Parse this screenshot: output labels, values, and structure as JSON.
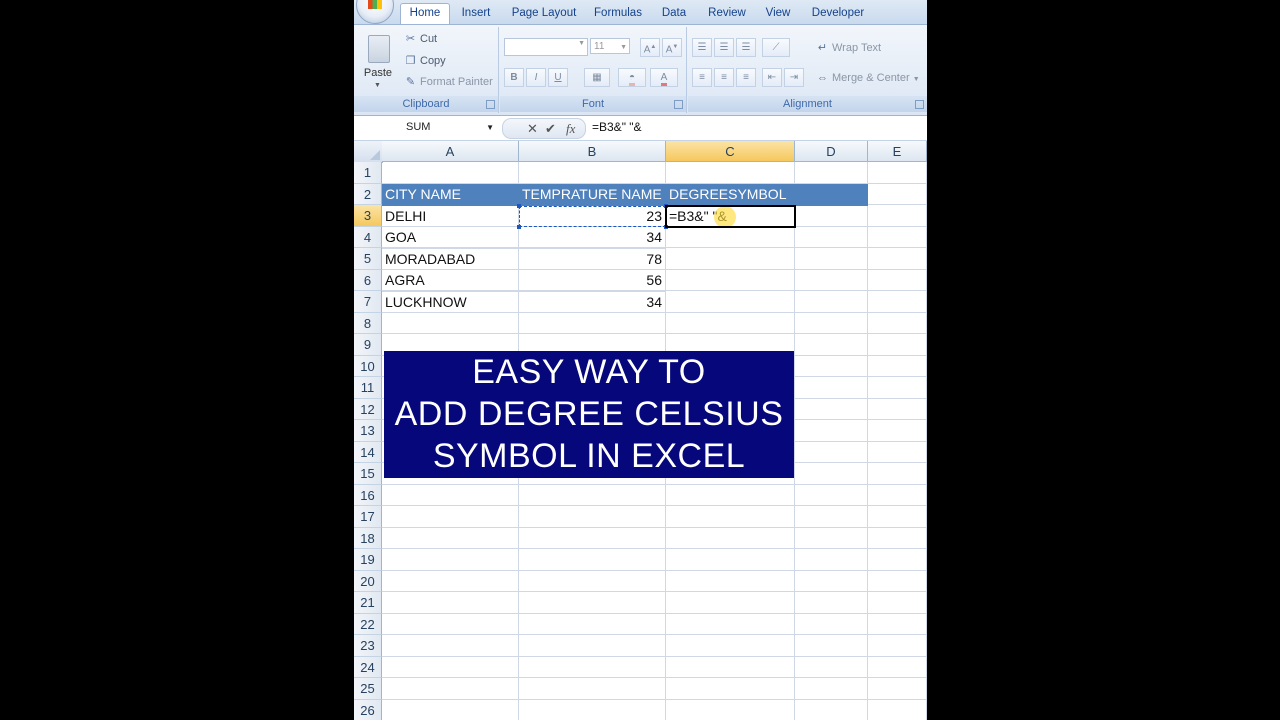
{
  "ribbon": {
    "tabs": [
      "Home",
      "Insert",
      "Page Layout",
      "Formulas",
      "Data",
      "Review",
      "View",
      "Developer"
    ],
    "active_tab": "Home",
    "clipboard": {
      "paste": "Paste",
      "cut": "Cut",
      "copy": "Copy",
      "format_painter": "Format Painter",
      "label": "Clipboard"
    },
    "font": {
      "size": "11",
      "label": "Font",
      "bold": "B",
      "italic": "I",
      "underline": "U",
      "font_color": "A"
    },
    "alignment": {
      "wrap_text": "Wrap Text",
      "merge_center": "Merge & Center",
      "label": "Alignment"
    }
  },
  "formula_bar": {
    "name_box": "SUM",
    "formula": "=B3&\" \"&"
  },
  "sheet": {
    "columns": [
      "A",
      "B",
      "C",
      "D",
      "E"
    ],
    "selected_column": "C",
    "rows": [
      "1",
      "2",
      "3",
      "4",
      "5",
      "6",
      "7",
      "8",
      "9",
      "10",
      "11",
      "12",
      "13",
      "14",
      "15",
      "16",
      "17",
      "18",
      "19",
      "20",
      "21",
      "22",
      "23",
      "24",
      "25",
      "26"
    ],
    "selected_row": "3",
    "headers": [
      "CITY NAME",
      "TEMPRATURE NAME",
      "DEGREESYMBOL"
    ],
    "data": [
      {
        "city": "DELHI",
        "temp": "23"
      },
      {
        "city": "GOA",
        "temp": "34"
      },
      {
        "city": "MORADABAD",
        "temp": "78"
      },
      {
        "city": "AGRA",
        "temp": "56"
      },
      {
        "city": "LUCKHNOW",
        "temp": "34"
      }
    ],
    "editing_cell_text": "=B3&\" \"&"
  },
  "banner": {
    "lines": [
      "EASY WAY TO",
      "ADD DEGREE CELSIUS",
      "SYMBOL IN EXCEL"
    ]
  },
  "colors": {
    "header_fill": "#4f81bd",
    "banner_fill": "#05077a",
    "selection": "#f5c85e"
  }
}
